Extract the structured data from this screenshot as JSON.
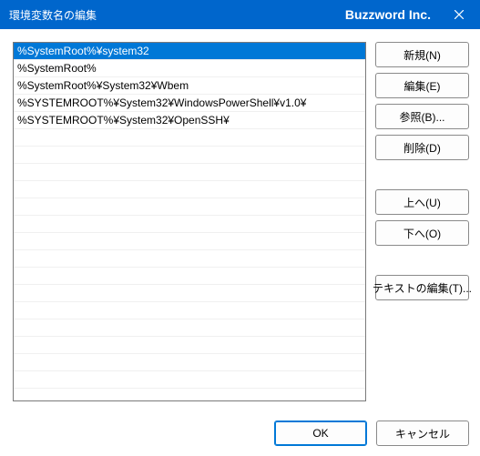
{
  "window": {
    "title": "環境変数名の編集",
    "brand": "Buzzword Inc."
  },
  "list": {
    "items": [
      {
        "value": "%SystemRoot%¥system32",
        "selected": true
      },
      {
        "value": "%SystemRoot%",
        "selected": false
      },
      {
        "value": "%SystemRoot%¥System32¥Wbem",
        "selected": false
      },
      {
        "value": "%SYSTEMROOT%¥System32¥WindowsPowerShell¥v1.0¥",
        "selected": false
      },
      {
        "value": "%SYSTEMROOT%¥System32¥OpenSSH¥",
        "selected": false
      }
    ]
  },
  "buttons": {
    "new": "新規(N)",
    "edit": "編集(E)",
    "browse": "参照(B)...",
    "delete": "削除(D)",
    "up": "上へ(U)",
    "down": "下へ(O)",
    "editText": "テキストの編集(T)..."
  },
  "footer": {
    "ok": "OK",
    "cancel": "キャンセル"
  }
}
